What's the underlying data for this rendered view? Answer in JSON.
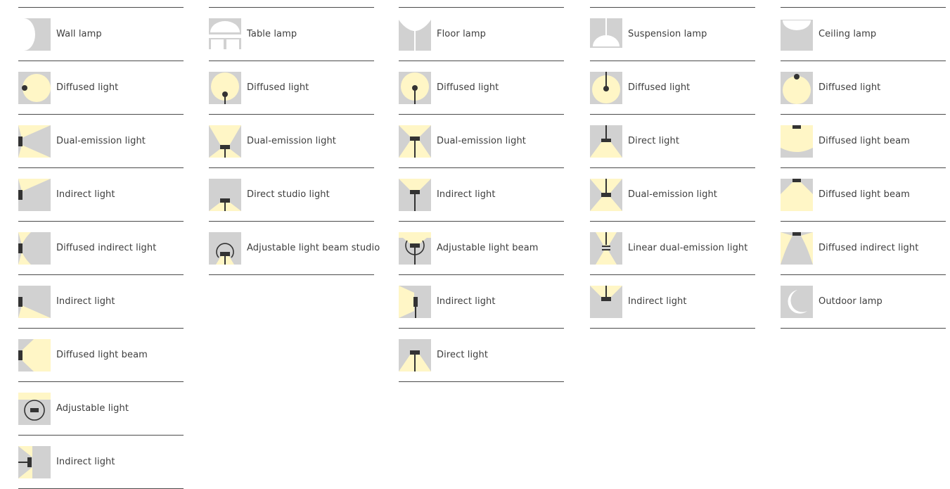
{
  "colors": {
    "tile": "#d1d1d1",
    "light": "#fff6c6",
    "fixture": "#333333"
  },
  "columns": [
    {
      "name": "wall",
      "items": [
        {
          "label": "Wall lamp",
          "icon": "wall-lamp-icon",
          "glyph": "wall-lamp"
        },
        {
          "label": "Diffused light",
          "icon": "diffused-light-icon",
          "glyph": "diff-left"
        },
        {
          "label": "Dual-emission light",
          "icon": "dual-emission-light-icon",
          "glyph": "wall-dual"
        },
        {
          "label": "Indirect light",
          "icon": "indirect-light-icon",
          "glyph": "wall-indirect-up"
        },
        {
          "label": "Diffused indirect light",
          "icon": "diffused-indirect-light-icon",
          "glyph": "wall-diff-indirect"
        },
        {
          "label": "Indirect light",
          "icon": "indirect-light-icon",
          "glyph": "wall-indirect-down"
        },
        {
          "label": "Diffused light beam",
          "icon": "diffused-light-beam-icon",
          "glyph": "wall-beam"
        },
        {
          "label": "Adjustable light",
          "icon": "adjustable-light-icon",
          "glyph": "adjustable"
        },
        {
          "label": "Indirect light",
          "icon": "indirect-light-icon",
          "glyph": "wall-arm"
        }
      ]
    },
    {
      "name": "table",
      "items": [
        {
          "label": "Table lamp",
          "icon": "table-lamp-icon",
          "glyph": "table-lamp"
        },
        {
          "label": "Diffused light",
          "icon": "diffused-light-icon",
          "glyph": "diff-stand"
        },
        {
          "label": "Dual-emission light",
          "icon": "dual-emission-light-icon",
          "glyph": "stand-dual"
        },
        {
          "label": "Direct studio light",
          "icon": "direct-studio-light-icon",
          "glyph": "stand-direct"
        },
        {
          "label": "Adjustable light beam studio",
          "icon": "adjustable-light-beam-studio-icon",
          "glyph": "stand-adjustable"
        }
      ]
    },
    {
      "name": "floor",
      "items": [
        {
          "label": "Floor lamp",
          "icon": "floor-lamp-icon",
          "glyph": "floor-lamp"
        },
        {
          "label": "Diffused light",
          "icon": "diffused-light-icon",
          "glyph": "diff-pole"
        },
        {
          "label": "Dual-emission light",
          "icon": "dual-emission-light-icon",
          "glyph": "pole-dual"
        },
        {
          "label": "Indirect light",
          "icon": "indirect-light-icon",
          "glyph": "pole-up"
        },
        {
          "label": "Adjustable light beam",
          "icon": "adjustable-light-beam-icon",
          "glyph": "pole-adjustable"
        },
        {
          "label": "Indirect light",
          "icon": "indirect-light-icon",
          "glyph": "pole-side"
        },
        {
          "label": "Direct light",
          "icon": "direct-light-icon",
          "glyph": "pole-down"
        }
      ]
    },
    {
      "name": "suspension",
      "items": [
        {
          "label": "Suspension lamp",
          "icon": "suspension-lamp-icon",
          "glyph": "suspension-lamp"
        },
        {
          "label": "Diffused light",
          "icon": "diffused-light-icon",
          "glyph": "diff-hang"
        },
        {
          "label": "Direct light",
          "icon": "direct-light-icon",
          "glyph": "hang-direct"
        },
        {
          "label": "Dual-emission light",
          "icon": "dual-emission-light-icon",
          "glyph": "hang-dual"
        },
        {
          "label": "Linear dual-emission light",
          "icon": "linear-dual-emission-light-icon",
          "glyph": "hang-linear"
        },
        {
          "label": "Indirect light",
          "icon": "indirect-light-icon",
          "glyph": "hang-up"
        }
      ]
    },
    {
      "name": "ceiling",
      "items": [
        {
          "label": "Ceiling lamp",
          "icon": "ceiling-lamp-icon",
          "glyph": "ceiling-lamp"
        },
        {
          "label": "Diffused light",
          "icon": "diffused-light-icon",
          "glyph": "diff-ceiling"
        },
        {
          "label": "Diffused light beam",
          "icon": "diffused-light-beam-icon",
          "glyph": "ceil-wide"
        },
        {
          "label": "Diffused light beam",
          "icon": "diffused-light-beam-icon",
          "glyph": "ceil-cone"
        },
        {
          "label": "Diffused indirect light",
          "icon": "diffused-indirect-light-icon",
          "glyph": "ceil-indirect"
        },
        {
          "label": "Outdoor lamp",
          "icon": "outdoor-lamp-icon",
          "glyph": "outdoor"
        }
      ]
    }
  ]
}
